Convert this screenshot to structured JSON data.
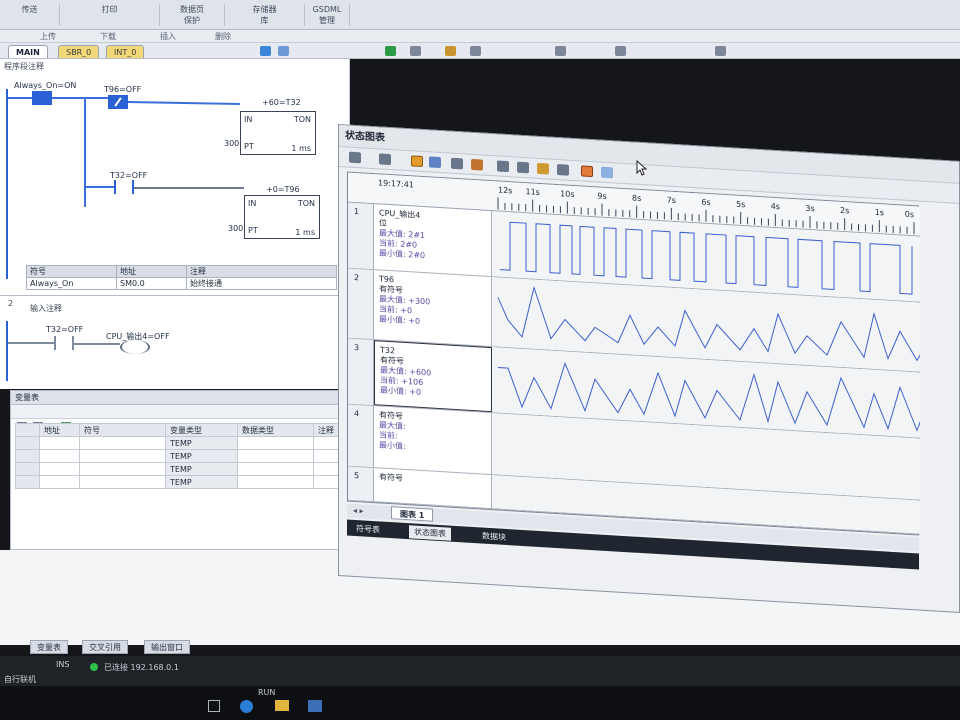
{
  "ribbon": {
    "groups": [
      {
        "top": "",
        "label": "传送"
      },
      {
        "top": "",
        "label": "打印"
      },
      {
        "top": "数据页",
        "label": "保护"
      },
      {
        "top": "存储器",
        "label": "库"
      },
      {
        "top": "GSDML",
        "label": "管理"
      },
      {
        "top": "",
        "label": "GSDML"
      }
    ]
  },
  "toolbar": {
    "upload_label": "上传",
    "download_label": "下载",
    "insert_label": "插入",
    "delete_label": "删除"
  },
  "editor_tabs": [
    "MAIN",
    "SBR_0",
    "INT_0"
  ],
  "editor": {
    "program_comment": "程序段注释",
    "network1": {
      "contact1": "Always_On=ON",
      "contact2": "T96=OFF",
      "contact3": "T32=OFF",
      "timer1_label": "+60=T32",
      "timer2_label": "+0=T96",
      "timer_type": "TON",
      "in_label": "IN",
      "pt_label": "PT",
      "preset1": "300",
      "preset2": "300",
      "time1": "1 ms",
      "time2": "1 ms"
    },
    "symbol_table": {
      "headers": [
        "符号",
        "地址",
        "注释"
      ],
      "row": [
        "Always_On",
        "SM0.0",
        "始终接通"
      ]
    },
    "network2": {
      "number": "2",
      "comment": "输入注释",
      "contact": "T32=OFF",
      "coil": "CPU_输出4=OFF"
    }
  },
  "var_table": {
    "title": "变量表",
    "headers": [
      "地址",
      "符号",
      "变量类型",
      "数据类型",
      "注释"
    ],
    "rows": [
      {
        "type": "TEMP"
      },
      {
        "type": "TEMP"
      },
      {
        "type": "TEMP"
      },
      {
        "type": "TEMP"
      }
    ]
  },
  "chart_window": {
    "title": "状态图表",
    "time": "19:17:41",
    "time_ticks": [
      "12s",
      "11s",
      "10s",
      "9s",
      "8s",
      "7s",
      "6s",
      "5s",
      "4s",
      "3s",
      "2s",
      "1s",
      "0s"
    ],
    "rows": [
      {
        "no": "1",
        "name": "CPU_输出4",
        "name2": "位",
        "max": "最大值:   2#1",
        "cur": "当前:     2#0",
        "min": "最小值:   2#0"
      },
      {
        "no": "2",
        "name": "T96",
        "name2": "有符号",
        "max": "最大值:   +300",
        "cur": "当前:     +0",
        "min": "最小值:   +0"
      },
      {
        "no": "3",
        "name": "T32",
        "name2": "有符号",
        "max": "最大值:   +600",
        "cur": "当前:     +106",
        "min": "最小值:   +0"
      },
      {
        "no": "4",
        "name": "",
        "name2": "有符号",
        "max": "最大值:",
        "cur": "当前:",
        "min": "最小值:"
      },
      {
        "no": "5",
        "name": "",
        "name2": "有符号",
        "max": "",
        "cur": "",
        "min": ""
      }
    ],
    "sheet_tab": "图表 1",
    "panel_tabs": [
      "符号表",
      "状态图表",
      "数据块"
    ]
  },
  "bottom_tabs": [
    "变量表",
    "交叉引用",
    "输出窗口"
  ],
  "status": {
    "ins": "INS",
    "connection": "已连接 192.168.0.1",
    "mode": "RUN",
    "hint": "自行联机"
  },
  "colors": {
    "accent": "#2a62d6",
    "trace": "#3d5fd0"
  }
}
